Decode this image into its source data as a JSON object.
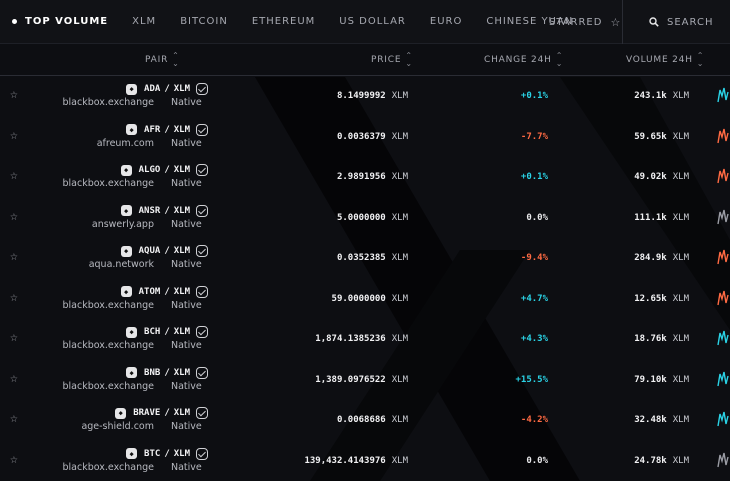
{
  "colors": {
    "up": "#2ad3e6",
    "down": "#ff6a43",
    "flat": "#e8e8ea"
  },
  "nav": {
    "tabs": [
      {
        "label": "TOP VOLUME",
        "active": true
      },
      {
        "label": "XLM"
      },
      {
        "label": "BITCOIN"
      },
      {
        "label": "ETHEREUM"
      },
      {
        "label": "US DOLLAR"
      },
      {
        "label": "EURO"
      },
      {
        "label": "CHINESE YUAN"
      }
    ],
    "starred_label": "STARRED",
    "search_label": "SEARCH"
  },
  "columns": {
    "pair": "PAIR",
    "price": "PRICE",
    "change": "CHANGE 24H",
    "volume": "VOLUME 24H"
  },
  "rows": [
    {
      "base": "ADA",
      "quote": "XLM",
      "icon": "ada-icon",
      "domain": "blackbox.exchange",
      "native": "Native",
      "price": "8.1499992",
      "price_unit": "XLM",
      "change": "+0.1%",
      "dir": "up",
      "volume": "243.1k",
      "volume_unit": "XLM",
      "spark": "#2ad3e6"
    },
    {
      "base": "AFR",
      "quote": "XLM",
      "icon": "afr-icon",
      "domain": "afreum.com",
      "native": "Native",
      "price": "0.0036379",
      "price_unit": "XLM",
      "change": "-7.7%",
      "dir": "down",
      "volume": "59.65k",
      "volume_unit": "XLM",
      "spark": "#ff6a43"
    },
    {
      "base": "ALGO",
      "quote": "XLM",
      "icon": "algo-icon",
      "domain": "blackbox.exchange",
      "native": "Native",
      "price": "2.9891956",
      "price_unit": "XLM",
      "change": "+0.1%",
      "dir": "up",
      "volume": "49.02k",
      "volume_unit": "XLM",
      "spark": "#ff6a43"
    },
    {
      "base": "ANSR",
      "quote": "XLM",
      "icon": "ansr-icon",
      "domain": "answerly.app",
      "native": "Native",
      "price": "5.0000000",
      "price_unit": "XLM",
      "change": "0.0%",
      "dir": "flat",
      "volume": "111.1k",
      "volume_unit": "XLM",
      "spark": "#9a9ca4"
    },
    {
      "base": "AQUA",
      "quote": "XLM",
      "icon": "aqua-icon",
      "domain": "aqua.network",
      "native": "Native",
      "price": "0.0352385",
      "price_unit": "XLM",
      "change": "-9.4%",
      "dir": "down",
      "volume": "284.9k",
      "volume_unit": "XLM",
      "spark": "#ff6a43"
    },
    {
      "base": "ATOM",
      "quote": "XLM",
      "icon": "atom-icon",
      "domain": "blackbox.exchange",
      "native": "Native",
      "price": "59.0000000",
      "price_unit": "XLM",
      "change": "+4.7%",
      "dir": "up",
      "volume": "12.65k",
      "volume_unit": "XLM",
      "spark": "#ff6a43"
    },
    {
      "base": "BCH",
      "quote": "XLM",
      "icon": "bch-icon",
      "domain": "blackbox.exchange",
      "native": "Native",
      "price": "1,874.1385236",
      "price_unit": "XLM",
      "change": "+4.3%",
      "dir": "up",
      "volume": "18.76k",
      "volume_unit": "XLM",
      "spark": "#2ad3e6"
    },
    {
      "base": "BNB",
      "quote": "XLM",
      "icon": "bnb-icon",
      "domain": "blackbox.exchange",
      "native": "Native",
      "price": "1,389.0976522",
      "price_unit": "XLM",
      "change": "+15.5%",
      "dir": "up",
      "volume": "79.10k",
      "volume_unit": "XLM",
      "spark": "#2ad3e6"
    },
    {
      "base": "BRAVE",
      "quote": "XLM",
      "icon": "brave-icon",
      "domain": "age-shield.com",
      "native": "Native",
      "price": "0.0068686",
      "price_unit": "XLM",
      "change": "-4.2%",
      "dir": "down",
      "volume": "32.48k",
      "volume_unit": "XLM",
      "spark": "#2ad3e6"
    },
    {
      "base": "BTC",
      "quote": "XLM",
      "icon": "btc-icon",
      "domain": "blackbox.exchange",
      "native": "Native",
      "price": "139,432.4143976",
      "price_unit": "XLM",
      "change": "0.0%",
      "dir": "flat",
      "volume": "24.78k",
      "volume_unit": "XLM",
      "spark": "#9a9ca4"
    }
  ]
}
